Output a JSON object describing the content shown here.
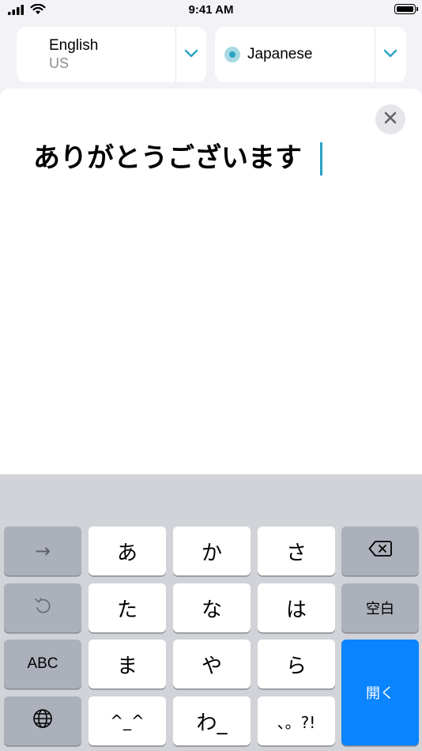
{
  "status_bar": {
    "time": "9:41 AM"
  },
  "source_language": {
    "name": "English",
    "variant": "US"
  },
  "target_language": {
    "name": "Japanese"
  },
  "input": {
    "text": "ありがとうございます"
  },
  "keyboard": {
    "row1": {
      "arrow": "→",
      "k1": "あ",
      "k2": "か",
      "k3": "さ"
    },
    "row2": {
      "k1": "た",
      "k2": "な",
      "k3": "は",
      "space": "空白"
    },
    "row3": {
      "abc": "ABC",
      "k1": "ま",
      "k2": "や",
      "k3": "ら",
      "enter": "開く"
    },
    "row4": {
      "k1": "^_^",
      "k2": "わ_",
      "k3": "、。?!"
    }
  },
  "colors": {
    "accent": "#2aa3c4",
    "keyboard_bg": "#d1d3d9",
    "enter_key": "#0a84ff"
  },
  "icons": [
    "signal-icon",
    "wifi-icon",
    "battery-icon",
    "chevron-down-icon",
    "close-icon",
    "backspace-icon",
    "undo-icon",
    "globe-icon"
  ]
}
